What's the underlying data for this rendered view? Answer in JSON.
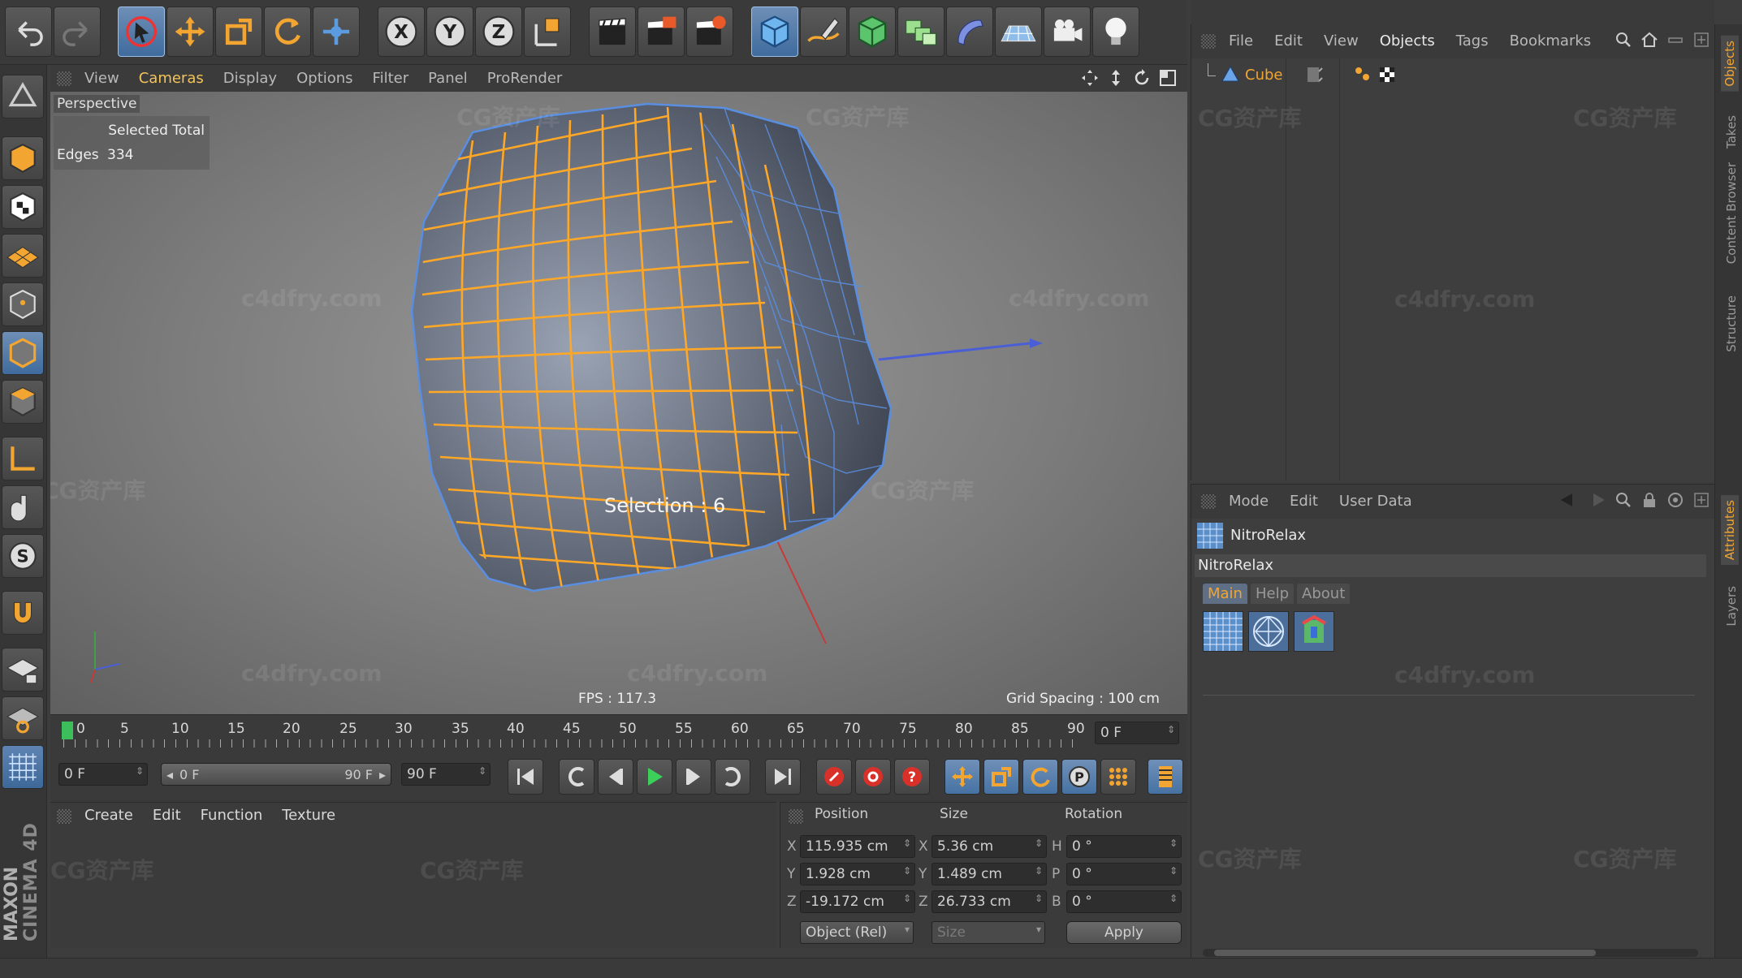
{
  "app": {
    "name": "CINEMA 4D",
    "vendor": "MAXON"
  },
  "viewport": {
    "menu": [
      "View",
      "Cameras",
      "Display",
      "Options",
      "Filter",
      "Panel",
      "ProRender"
    ],
    "camera_label": "Perspective",
    "hud_selected_total": "Selected Total",
    "hud_edges_label": "Edges",
    "hud_edges_value": "334",
    "selection_text": "Selection : 6",
    "fps_text": "FPS : 117.3",
    "grid_spacing_text": "Grid Spacing : 100 cm"
  },
  "timeline": {
    "ticks": [
      "0",
      "5",
      "10",
      "15",
      "20",
      "25",
      "30",
      "35",
      "40",
      "45",
      "50",
      "55",
      "60",
      "65",
      "70",
      "75",
      "80",
      "85",
      "90"
    ],
    "current_frame": "0 F",
    "start_field": "0 F",
    "range_start": "0 F",
    "range_end": "90 F",
    "end_field": "90 F"
  },
  "material_panel": {
    "menu": [
      "Create",
      "Edit",
      "Function",
      "Texture"
    ]
  },
  "coords": {
    "headers": {
      "position": "Position",
      "size": "Size",
      "rotation": "Rotation"
    },
    "rows": [
      {
        "axis": "X",
        "pos": "115.935 cm",
        "size_axis": "X",
        "size": "5.36 cm",
        "rot_axis": "H",
        "rot": "0 °"
      },
      {
        "axis": "Y",
        "pos": "1.928 cm",
        "size_axis": "Y",
        "size": "1.489 cm",
        "rot_axis": "P",
        "rot": "0 °"
      },
      {
        "axis": "Z",
        "pos": "-19.172 cm",
        "size_axis": "Z",
        "size": "26.733 cm",
        "rot_axis": "B",
        "rot": "0 °"
      }
    ],
    "mode_select": "Object (Rel)",
    "size_select": "Size",
    "apply_label": "Apply"
  },
  "object_manager": {
    "menu": [
      "File",
      "Edit",
      "View",
      "Objects",
      "Tags",
      "Bookmarks"
    ],
    "object_name": "Cube"
  },
  "attributes": {
    "menu": [
      "Mode",
      "Edit",
      "User Data"
    ],
    "plugin_title": "NitroRelax",
    "plugin_subtitle": "NitroRelax",
    "tabs": [
      "Main",
      "Help",
      "About"
    ]
  },
  "side_tabs": [
    "Objects",
    "Takes",
    "Content Browser",
    "Structure",
    "Attributes",
    "Layers"
  ],
  "watermarks": {
    "cg": "CG资产库",
    "site": "c4dfry.com"
  },
  "colors": {
    "accent": "#f2a531",
    "selection": "#ffa726",
    "mesh_edge": "#5a8ee0"
  }
}
